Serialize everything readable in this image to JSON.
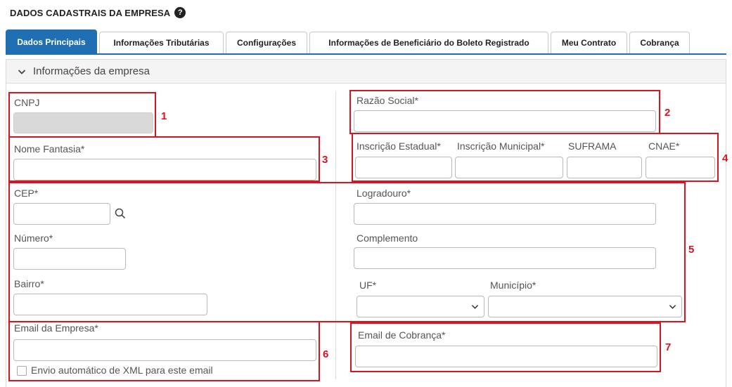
{
  "page": {
    "title": "DADOS CADASTRAIS DA EMPRESA"
  },
  "tabs": [
    {
      "label": "Dados Principais",
      "active": true
    },
    {
      "label": "Informações Tributárias"
    },
    {
      "label": "Configurações"
    },
    {
      "label": "Informações de Beneficiário do Boleto Registrado"
    },
    {
      "label": "Meu Contrato"
    },
    {
      "label": "Cobrança"
    }
  ],
  "section": {
    "title": "Informações da empresa"
  },
  "fields": {
    "cnpj": {
      "label": "CNPJ",
      "value": ""
    },
    "razao_social": {
      "label": "Razão Social*",
      "value": ""
    },
    "nome_fantasia": {
      "label": "Nome Fantasia*",
      "value": ""
    },
    "inscricao_estadual": {
      "label": "Inscrição Estadual*",
      "value": ""
    },
    "inscricao_municipal": {
      "label": "Inscrição Municipal*",
      "value": ""
    },
    "suframa": {
      "label": "SUFRAMA",
      "value": ""
    },
    "cnae": {
      "label": "CNAE*",
      "value": ""
    },
    "cep": {
      "label": "CEP*",
      "value": ""
    },
    "logradouro": {
      "label": "Logradouro*",
      "value": ""
    },
    "numero": {
      "label": "Número*",
      "value": ""
    },
    "complemento": {
      "label": "Complemento",
      "value": ""
    },
    "bairro": {
      "label": "Bairro*",
      "value": ""
    },
    "uf": {
      "label": "UF*",
      "value": ""
    },
    "municipio": {
      "label": "Município*",
      "value": ""
    },
    "email_empresa": {
      "label": "Email da Empresa*",
      "value": ""
    },
    "envio_xml": {
      "label": "Envio automático de XML para este email",
      "checked": false
    },
    "email_cobranca": {
      "label": "Email de Cobrança*",
      "value": ""
    }
  },
  "annotations": [
    "1",
    "2",
    "3",
    "4",
    "5",
    "6",
    "7"
  ],
  "colors": {
    "accent": "#1f6fb2",
    "annotation": "#d7141f"
  }
}
